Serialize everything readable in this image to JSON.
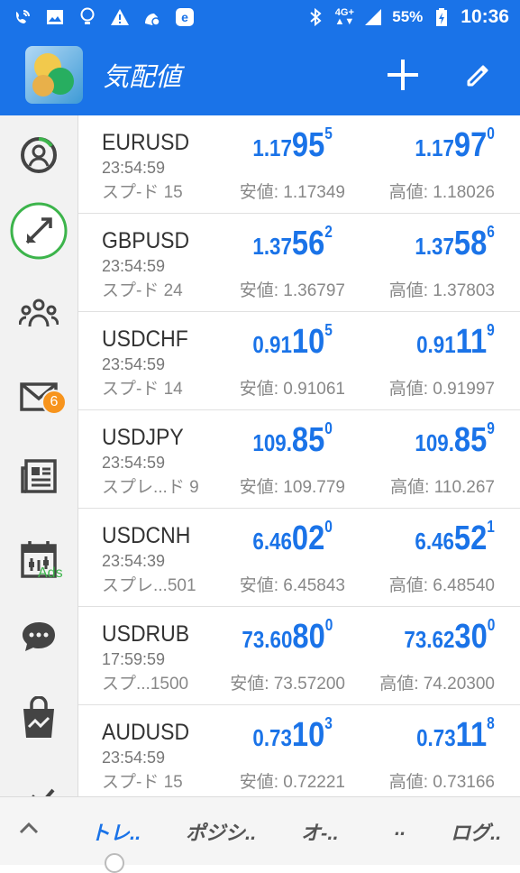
{
  "status_bar": {
    "network": "4G+",
    "battery": "55%",
    "time": "10:36",
    "icons": [
      "wifi-calling-icon",
      "gallery-icon",
      "bulb-icon",
      "warning-icon",
      "app-icon",
      "e-app-icon",
      "bluetooth-icon",
      "signal-icon",
      "battery-charging-icon"
    ]
  },
  "app_bar": {
    "title": "気配値",
    "add_icon": "plus-icon",
    "edit_icon": "pencil-icon"
  },
  "nav": {
    "mail_badge": "6",
    "ads_label": "Ads",
    "items": [
      "account-icon",
      "trade-icon",
      "community-icon",
      "mail-icon",
      "news-icon",
      "calendar-icon",
      "chat-icon",
      "market-icon",
      "chart-icon"
    ]
  },
  "quotes": [
    {
      "symbol": "EURUSD",
      "time": "23:54:59",
      "spread": "スプ-ド 15",
      "bid": {
        "small": "1.17",
        "big": "95",
        "sup": "5"
      },
      "ask": {
        "small": "1.17",
        "big": "97",
        "sup": "0"
      },
      "low": "安値: 1.17349",
      "high": "高値: 1.18026"
    },
    {
      "symbol": "GBPUSD",
      "time": "23:54:59",
      "spread": "スプ-ド 24",
      "bid": {
        "small": "1.37",
        "big": "56",
        "sup": "2"
      },
      "ask": {
        "small": "1.37",
        "big": "58",
        "sup": "6"
      },
      "low": "安値: 1.36797",
      "high": "高値: 1.37803"
    },
    {
      "symbol": "USDCHF",
      "time": "23:54:59",
      "spread": "スプ-ド 14",
      "bid": {
        "small": "0.91",
        "big": "10",
        "sup": "5"
      },
      "ask": {
        "small": "0.91",
        "big": "11",
        "sup": "9"
      },
      "low": "安値: 0.91061",
      "high": "高値: 0.91997"
    },
    {
      "symbol": "USDJPY",
      "time": "23:54:59",
      "spread": "スプレ...ド 9",
      "bid": {
        "small": "109.",
        "big": "85",
        "sup": "0"
      },
      "ask": {
        "small": "109.",
        "big": "85",
        "sup": "9"
      },
      "low": "安値: 109.779",
      "high": "高値: 110.267"
    },
    {
      "symbol": "USDCNH",
      "time": "23:54:39",
      "spread": "スプレ...501",
      "bid": {
        "small": "6.46",
        "big": "02",
        "sup": "0"
      },
      "ask": {
        "small": "6.46",
        "big": "52",
        "sup": "1"
      },
      "low": "安値: 6.45843",
      "high": "高値: 6.48540"
    },
    {
      "symbol": "USDRUB",
      "time": "17:59:59",
      "spread": "スプ...1500",
      "bid": {
        "small": "73.60",
        "big": "80",
        "sup": "0"
      },
      "ask": {
        "small": "73.62",
        "big": "30",
        "sup": "0"
      },
      "low": "安値: 73.57200",
      "high": "高値: 74.20300"
    },
    {
      "symbol": "AUDUSD",
      "time": "23:54:59",
      "spread": "スプ-ド 15",
      "bid": {
        "small": "0.73",
        "big": "10",
        "sup": "3"
      },
      "ask": {
        "small": "0.73",
        "big": "11",
        "sup": "8"
      },
      "low": "安値: 0.72221",
      "high": "高値: 0.73166"
    }
  ],
  "bottom_tabs": [
    {
      "label": "トレ..",
      "active": true
    },
    {
      "label": "ポジシ..",
      "active": false
    },
    {
      "label": "オ-..",
      "active": false
    },
    {
      "label": "..",
      "active": false
    },
    {
      "label": "ログ..",
      "active": false
    }
  ],
  "colors": {
    "primary": "#1a73e8",
    "badge": "#f7941d",
    "highlight": "#3cb44b"
  }
}
